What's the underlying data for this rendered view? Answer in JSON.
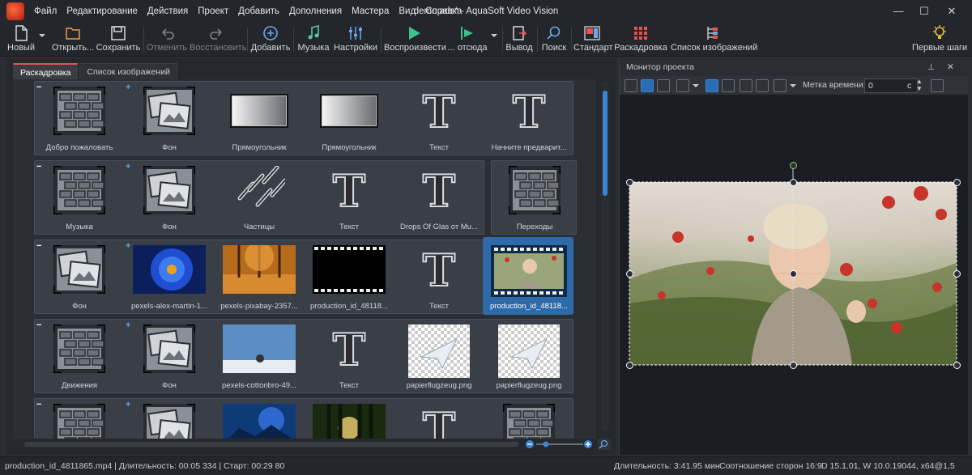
{
  "menu": {
    "items": [
      "Файл",
      "Редактирование",
      "Действия",
      "Проект",
      "Добавить",
      "Дополнения",
      "Мастера",
      "Вид",
      "Справка"
    ]
  },
  "window": {
    "title": "demo.ads* - AquaSoft Video Vision",
    "minimize": "—",
    "maximize": "☐",
    "close": "✕"
  },
  "toolbar": {
    "new": "Новый",
    "open": "Открыть...",
    "save": "Сохранить",
    "undo": "Отменить",
    "redo": "Восстановить",
    "add": "Добавить",
    "music": "Музыка",
    "settings": "Настройки",
    "play": "Воспроизвести",
    "play_from": "... отсюда",
    "output": "Вывод",
    "search": "Поиск",
    "standard": "Стандарт",
    "storyboard": "Раскадровка",
    "imagelist": "Список изображений",
    "first_steps": "Первые шаги"
  },
  "tabs": [
    "Раскадровка",
    "Список изображений"
  ],
  "storyboard": {
    "rows": [
      {
        "cells": [
          "Добро пожаловать",
          "Фон",
          "Прямоугольник",
          "Прямоугольник",
          "Текст",
          "Начните предварит..."
        ],
        "types": [
          "bricks",
          "photos",
          "grad",
          "grad",
          "T",
          "T"
        ]
      },
      {
        "cells": [
          "Музыка",
          "Фон",
          "Частицы",
          "Текст",
          "Drops Of Glas от Mu..."
        ],
        "types": [
          "bricks",
          "photos",
          "particles",
          "T",
          "T"
        ],
        "extra": {
          "label": "Переходы",
          "type": "bricks"
        }
      },
      {
        "cells": [
          "Фон",
          "pexels-alex-martin-1...",
          "pexels-pixabay-2357...",
          "production_id_48118...",
          "Текст",
          "production_id_48118..."
        ],
        "types": [
          "photos",
          "blue",
          "autumn",
          "film",
          "T",
          "selected"
        ]
      },
      {
        "cells": [
          "Движения",
          "Фон",
          "pexels-cottonbro-49...",
          "Текст",
          "papierflugzeug.png",
          "papierflugzeug.png"
        ],
        "types": [
          "bricks",
          "photos",
          "sky",
          "T",
          "plane",
          "plane"
        ]
      },
      {
        "cells": [
          "",
          "",
          "",
          "",
          "",
          ""
        ],
        "types": [
          "bricks",
          "photos",
          "bluesky",
          "forest",
          "T",
          "bricks"
        ]
      }
    ]
  },
  "monitor": {
    "title": "Монитор проекта",
    "time_label": "Метка времени:",
    "time_value": "0",
    "time_unit": "с"
  },
  "status": {
    "left": "production_id_4811865.mp4 | Длительность: 00:05 334 | Старт: 00:29 80",
    "duration": "Длительность: 3:41.95 мин",
    "ratio": "Соотношение сторон 16:9",
    "version": "D 15.1.01, W 10.0.19044, x64@1,5"
  }
}
